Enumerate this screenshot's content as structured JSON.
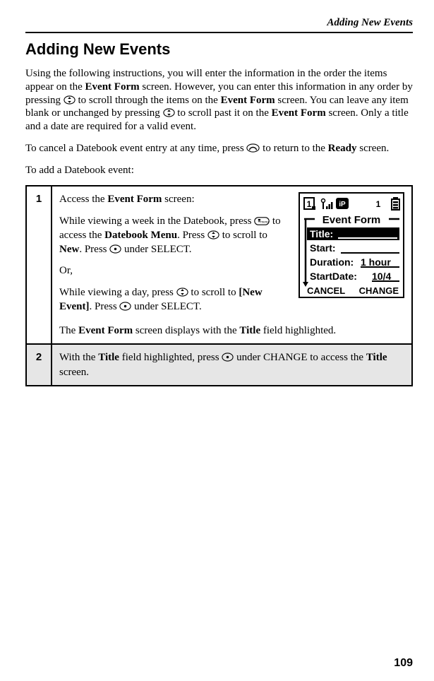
{
  "runningHead": "Adding New Events",
  "title": "Adding New Events",
  "intro": {
    "p1a": "Using the following instructions, you will enter the information in the order the items appear on the ",
    "p1b": "Event Form",
    "p1c": " screen. However, you can enter this information in any order by pressing ",
    "p1d": " to scroll through the items on the ",
    "p1e": "Event Form",
    "p1f": " screen. You can leave any item blank or unchanged by pressing ",
    "p1g": " to scroll past it on the ",
    "p1h": "Event Form",
    "p1i": " screen. Only a title and a date are required for a valid event.",
    "p2a": "To cancel a Datebook event entry at any time, press ",
    "p2b": " to return to the ",
    "p2c": "Ready",
    "p2d": " screen.",
    "p3": "To add a Datebook event:"
  },
  "step1": {
    "num": "1",
    "line1a": "Access the ",
    "line1b": "Event Form",
    "line1c": " screen:",
    "line2a": "While viewing a week in the Datebook, press ",
    "line2b": " to access the ",
    "line2c": "Datebook Menu",
    "line2d": ". Press ",
    "line2e": " to scroll to ",
    "line2f": "New",
    "line2g": ". Press ",
    "line2h": " under SELECT.",
    "or": "Or,",
    "line3a": "While viewing a day, press ",
    "line3b": " to scroll to ",
    "line3c": "[New Event]",
    "line3d": ". Press ",
    "line3e": " under SELECT.",
    "line4a": "The ",
    "line4b": "Event Form",
    "line4c": " screen displays with the ",
    "line4d": "Title",
    "line4e": " field highlighted."
  },
  "step2": {
    "num": "2",
    "a": "With the ",
    "b": "Title",
    "c": " field highlighted, press ",
    "d": " under CHANGE to access the ",
    "e": "Title",
    "f": " screen."
  },
  "lcd": {
    "header": "Event Form",
    "titleLabel": "Title:",
    "startLabel": "Start:",
    "durationLabel": "Duration:",
    "durationVal": "1 hour",
    "startDateLabel": "StartDate:",
    "startDateVal": "10/4",
    "cancel": "CANCEL",
    "change": "CHANGE",
    "statusNum": "1",
    "battNum": "1"
  },
  "pageNum": "109"
}
